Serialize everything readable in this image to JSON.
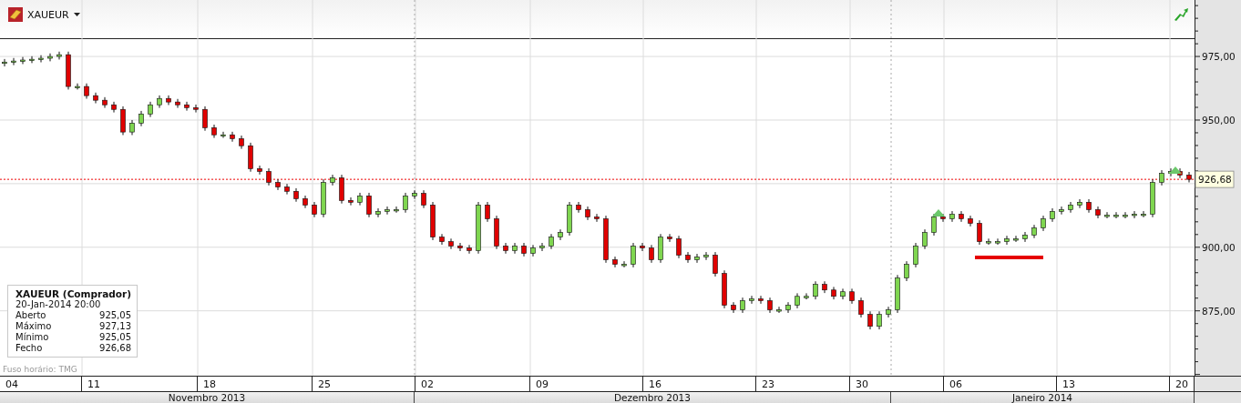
{
  "symbol": {
    "name": "XAUEUR"
  },
  "chart": {
    "chart_data": {
      "type": "candlestick",
      "ohlc": [
        [
          972.3,
          974.0,
          971.1,
          972.8
        ],
        [
          972.8,
          974.4,
          971.6,
          973.2
        ],
        [
          973.2,
          974.8,
          972.0,
          973.6
        ],
        [
          973.6,
          975.1,
          972.4,
          973.9
        ],
        [
          973.9,
          975.5,
          972.7,
          974.3
        ],
        [
          974.3,
          976.2,
          973.1,
          975.0
        ],
        [
          975.0,
          976.9,
          973.8,
          975.7
        ],
        [
          975.7,
          976.9,
          962.0,
          963.2
        ],
        [
          963.2,
          964.4,
          962.0,
          963.2
        ],
        [
          963.2,
          964.4,
          958.4,
          959.6
        ],
        [
          959.6,
          960.8,
          956.6,
          957.8
        ],
        [
          957.8,
          959.0,
          954.8,
          956.0
        ],
        [
          956.0,
          957.2,
          953.0,
          954.2
        ],
        [
          954.2,
          955.4,
          944.1,
          945.3
        ],
        [
          945.3,
          950.0,
          944.1,
          948.8
        ],
        [
          948.8,
          953.6,
          947.6,
          952.4
        ],
        [
          952.4,
          957.2,
          951.2,
          956.0
        ],
        [
          956.0,
          959.7,
          954.8,
          958.5
        ],
        [
          958.5,
          959.7,
          955.9,
          957.1
        ],
        [
          957.1,
          958.3,
          954.8,
          956.0
        ],
        [
          956.0,
          957.2,
          953.7,
          954.9
        ],
        [
          954.9,
          956.1,
          953.0,
          954.2
        ],
        [
          954.2,
          955.4,
          945.8,
          947.0
        ],
        [
          947.0,
          948.2,
          943.0,
          944.2
        ],
        [
          944.2,
          945.4,
          943.0,
          944.2
        ],
        [
          944.2,
          945.4,
          941.5,
          942.7
        ],
        [
          942.7,
          943.9,
          938.7,
          939.9
        ],
        [
          939.9,
          941.1,
          929.7,
          930.9
        ],
        [
          930.9,
          932.1,
          928.6,
          929.8
        ],
        [
          929.8,
          931.0,
          924.3,
          925.5
        ],
        [
          925.5,
          926.7,
          922.5,
          923.7
        ],
        [
          923.7,
          924.9,
          920.8,
          922.0
        ],
        [
          922.0,
          923.2,
          917.9,
          919.1
        ],
        [
          919.1,
          920.3,
          915.4,
          916.6
        ],
        [
          916.6,
          917.8,
          911.8,
          913.0
        ],
        [
          913.0,
          926.7,
          911.8,
          925.5
        ],
        [
          925.5,
          928.5,
          924.3,
          927.3
        ],
        [
          927.3,
          928.5,
          917.2,
          918.4
        ],
        [
          918.4,
          919.6,
          916.5,
          917.7
        ],
        [
          917.7,
          921.4,
          916.5,
          920.2
        ],
        [
          920.2,
          921.4,
          911.8,
          913.0
        ],
        [
          913.0,
          915.3,
          911.8,
          914.1
        ],
        [
          914.1,
          916.0,
          912.9,
          914.8
        ],
        [
          914.8,
          916.0,
          913.6,
          914.8
        ],
        [
          914.8,
          921.4,
          913.6,
          920.2
        ],
        [
          920.2,
          922.4,
          919.0,
          921.2
        ],
        [
          921.2,
          922.4,
          915.4,
          916.6
        ],
        [
          916.6,
          917.8,
          902.8,
          904.0
        ],
        [
          904.0,
          905.2,
          901.0,
          902.2
        ],
        [
          902.2,
          903.4,
          899.3,
          900.5
        ],
        [
          900.5,
          901.7,
          898.5,
          899.7
        ],
        [
          899.7,
          900.9,
          897.5,
          898.7
        ],
        [
          898.7,
          917.8,
          897.5,
          916.6
        ],
        [
          916.6,
          917.8,
          910.0,
          911.2
        ],
        [
          911.2,
          912.4,
          899.3,
          900.5
        ],
        [
          900.5,
          901.7,
          897.5,
          898.7
        ],
        [
          898.7,
          901.7,
          897.5,
          900.5
        ],
        [
          900.5,
          901.7,
          896.4,
          897.6
        ],
        [
          897.6,
          900.9,
          896.4,
          899.7
        ],
        [
          899.7,
          901.7,
          898.5,
          900.5
        ],
        [
          900.5,
          905.2,
          899.3,
          904.0
        ],
        [
          904.0,
          907.0,
          902.8,
          905.8
        ],
        [
          905.8,
          917.8,
          904.6,
          916.6
        ],
        [
          916.6,
          917.8,
          913.6,
          914.8
        ],
        [
          914.8,
          916.0,
          910.7,
          911.9
        ],
        [
          911.9,
          913.1,
          910.0,
          911.2
        ],
        [
          911.2,
          912.4,
          893.9,
          895.1
        ],
        [
          895.1,
          896.3,
          892.1,
          893.3
        ],
        [
          893.3,
          894.5,
          892.1,
          893.3
        ],
        [
          893.3,
          901.7,
          892.1,
          900.5
        ],
        [
          900.5,
          901.7,
          898.5,
          899.7
        ],
        [
          899.7,
          900.9,
          893.9,
          895.1
        ],
        [
          895.1,
          905.2,
          893.9,
          904.0
        ],
        [
          904.0,
          905.2,
          902.1,
          903.3
        ],
        [
          903.3,
          904.5,
          895.7,
          896.9
        ],
        [
          896.9,
          898.1,
          893.9,
          895.1
        ],
        [
          895.1,
          897.4,
          893.9,
          896.2
        ],
        [
          896.2,
          898.1,
          895.0,
          896.9
        ],
        [
          896.9,
          898.1,
          888.5,
          889.7
        ],
        [
          889.7,
          890.9,
          876.0,
          877.2
        ],
        [
          877.2,
          878.4,
          874.2,
          875.4
        ],
        [
          875.4,
          880.2,
          874.2,
          879.0
        ],
        [
          879.0,
          880.9,
          877.8,
          879.7
        ],
        [
          879.7,
          880.9,
          877.8,
          879.0
        ],
        [
          879.0,
          880.2,
          874.2,
          875.4
        ],
        [
          875.4,
          876.6,
          874.2,
          875.4
        ],
        [
          875.4,
          878.4,
          874.2,
          877.2
        ],
        [
          877.2,
          881.9,
          876.0,
          880.7
        ],
        [
          880.7,
          881.9,
          879.5,
          880.7
        ],
        [
          880.7,
          886.6,
          879.5,
          885.4
        ],
        [
          885.4,
          886.6,
          882.0,
          883.2
        ],
        [
          883.2,
          884.4,
          879.5,
          880.7
        ],
        [
          880.7,
          883.7,
          879.5,
          882.5
        ],
        [
          882.5,
          883.7,
          877.8,
          879.0
        ],
        [
          879.0,
          880.2,
          872.4,
          873.6
        ],
        [
          873.6,
          874.8,
          867.7,
          868.9
        ],
        [
          868.9,
          874.8,
          867.7,
          873.6
        ],
        [
          873.6,
          876.6,
          872.4,
          875.4
        ],
        [
          875.4,
          889.1,
          874.2,
          887.9
        ],
        [
          887.9,
          894.5,
          886.7,
          893.3
        ],
        [
          893.3,
          901.7,
          892.1,
          900.5
        ],
        [
          900.5,
          907.0,
          899.3,
          905.8
        ],
        [
          905.8,
          913.1,
          904.6,
          911.9
        ],
        [
          911.9,
          913.1,
          910.0,
          911.2
        ],
        [
          911.2,
          914.2,
          910.0,
          913.0
        ],
        [
          913.0,
          914.2,
          910.0,
          911.2
        ],
        [
          911.2,
          912.4,
          908.2,
          909.4
        ],
        [
          909.4,
          910.6,
          901.0,
          902.2
        ],
        [
          902.2,
          903.4,
          901.0,
          902.2
        ],
        [
          902.2,
          903.4,
          901.0,
          902.2
        ],
        [
          902.2,
          904.5,
          901.0,
          903.3
        ],
        [
          903.3,
          904.5,
          902.1,
          903.3
        ],
        [
          903.3,
          906.0,
          902.1,
          904.8
        ],
        [
          904.8,
          908.8,
          903.6,
          907.6
        ],
        [
          907.6,
          912.4,
          906.4,
          911.2
        ],
        [
          911.2,
          915.3,
          910.0,
          914.1
        ],
        [
          914.1,
          916.0,
          912.9,
          914.8
        ],
        [
          914.8,
          917.8,
          913.6,
          916.6
        ],
        [
          916.6,
          918.9,
          915.4,
          917.7
        ],
        [
          917.7,
          918.9,
          913.6,
          914.8
        ],
        [
          914.8,
          916.0,
          911.4,
          912.6
        ],
        [
          912.6,
          913.8,
          911.4,
          912.6
        ],
        [
          912.6,
          913.8,
          911.4,
          912.6
        ],
        [
          912.6,
          913.8,
          911.4,
          912.6
        ],
        [
          912.6,
          914.2,
          911.4,
          913.0
        ],
        [
          913.0,
          914.2,
          911.8,
          913.0
        ],
        [
          913.0,
          926.7,
          911.8,
          925.5
        ],
        [
          925.5,
          930.3,
          924.3,
          929.1
        ],
        [
          929.1,
          931.0,
          927.9,
          929.8
        ],
        [
          929.8,
          931.0,
          927.2,
          928.4
        ],
        [
          928.4,
          929.6,
          925.5,
          926.7
        ]
      ],
      "ylim": [
        849.5,
        997.2
      ],
      "grid": true,
      "yticks": [
        {
          "value": 875,
          "label": "875,00"
        },
        {
          "value": 900,
          "label": "900,00"
        },
        {
          "value": 950,
          "label": "950,00"
        },
        {
          "value": 975,
          "label": "975,00"
        }
      ],
      "ref_lines": [
        {
          "axis": "y",
          "value": 926.7
        }
      ]
    },
    "current_price": "926,68",
    "timezone": "Fuso horário: TMG"
  },
  "days": [
    {
      "label": "04"
    },
    {
      "label": "11"
    },
    {
      "label": "18"
    },
    {
      "label": "25"
    },
    {
      "label": "02"
    },
    {
      "label": "09"
    },
    {
      "label": "16"
    },
    {
      "label": "23"
    },
    {
      "label": "30"
    },
    {
      "label": "06"
    },
    {
      "label": "13"
    },
    {
      "label": "20"
    }
  ],
  "months": [
    {
      "label": "Novembro 2013"
    },
    {
      "label": "Dezembro 2013"
    },
    {
      "label": "Janeiro 2014"
    }
  ],
  "info_box": {
    "title": "XAUEUR (Comprador)",
    "datetime": "20-Jan-2014 20:00",
    "rows": [
      {
        "label": "Aberto",
        "value": "925,05"
      },
      {
        "label": "Máximo",
        "value": "927,13"
      },
      {
        "label": "Mínimo",
        "value": "925,05"
      },
      {
        "label": "Fecho",
        "value": "926,68"
      }
    ]
  }
}
